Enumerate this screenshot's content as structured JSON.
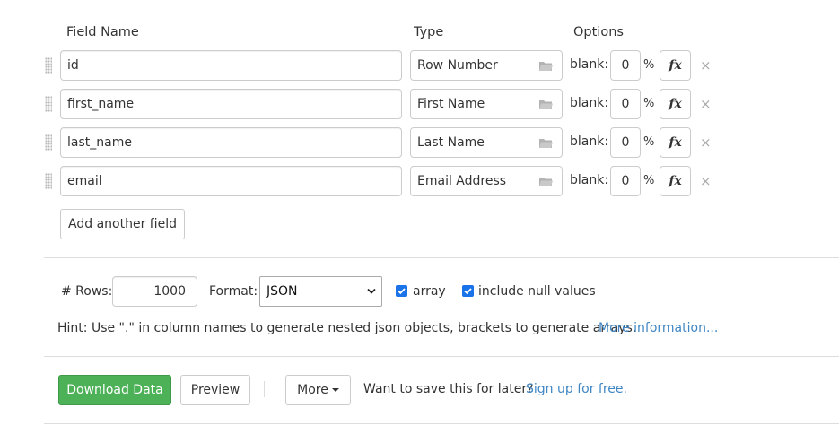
{
  "headers": {
    "field_name": "Field Name",
    "type": "Type",
    "options": "Options"
  },
  "fields": [
    {
      "name": "id",
      "type": "Row Number",
      "blank_label": "blank:",
      "blank": "0",
      "pct": "%",
      "fx": "fx",
      "remove": "×"
    },
    {
      "name": "first_name",
      "type": "First Name",
      "blank_label": "blank:",
      "blank": "0",
      "pct": "%",
      "fx": "fx",
      "remove": "×"
    },
    {
      "name": "last_name",
      "type": "Last Name",
      "blank_label": "blank:",
      "blank": "0",
      "pct": "%",
      "fx": "fx",
      "remove": "×"
    },
    {
      "name": "email",
      "type": "Email Address",
      "blank_label": "blank:",
      "blank": "0",
      "pct": "%",
      "fx": "fx",
      "remove": "×"
    }
  ],
  "add_field_label": "Add another field",
  "settings": {
    "rows_label": "# Rows:",
    "rows_value": "1000",
    "format_label": "Format:",
    "format_value": "JSON",
    "array_label": "array",
    "array_checked": true,
    "null_label": "include null values",
    "null_checked": true
  },
  "hint": {
    "text": "Hint: Use \".\" in column names to generate nested json objects, brackets to generate arrays.",
    "link": "More information..."
  },
  "actions": {
    "download": "Download Data",
    "preview": "Preview",
    "more": "More",
    "save_prompt": "Want to save this for later?",
    "signup": "Sign up for free."
  },
  "colors": {
    "accent_green": "#4cb157",
    "link_blue": "#3f86c4",
    "checkbox_blue": "#1a73e8"
  }
}
